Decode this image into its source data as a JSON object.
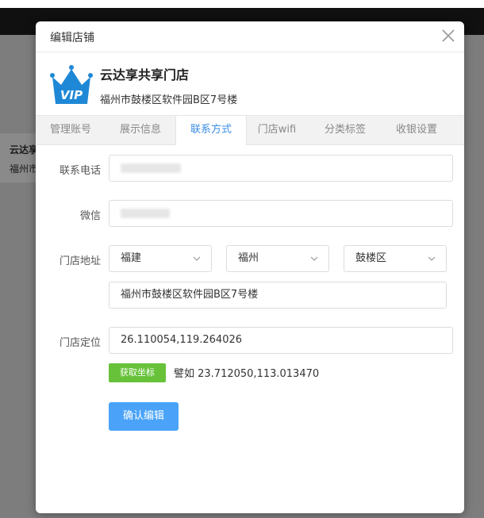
{
  "background": {
    "store_card": {
      "name": "云达享",
      "addr": "福州市"
    }
  },
  "modal": {
    "title": "编辑店铺",
    "store": {
      "name": "云达享共享门店",
      "address": "福州市鼓楼区软件园B区7号楼",
      "logo_text": "VIP"
    },
    "tabs": [
      "管理账号",
      "展示信息",
      "联系方式",
      "门店wifi",
      "分类标签",
      "收银设置"
    ],
    "active_tab": "联系方式",
    "form": {
      "phone": {
        "label": "联系电话",
        "value": "1896____"
      },
      "wechat": {
        "label": "微信",
        "value": "pn_dragon"
      },
      "address": {
        "label": "门店地址",
        "province": "福建",
        "city": "福州",
        "district": "鼓楼区",
        "detail": "福州市鼓楼区软件园B区7号楼"
      },
      "location": {
        "label": "门店定位",
        "value": "26.110054,119.264026",
        "get_button": "获取坐标",
        "hint": "譬如 23.712050,113.013470"
      },
      "submit": "确认编辑"
    }
  },
  "colors": {
    "accent": "#3a8ee6",
    "green": "#67c23a",
    "primary_button": "#4aa3f8",
    "logo_blue": "#1e88d6"
  }
}
